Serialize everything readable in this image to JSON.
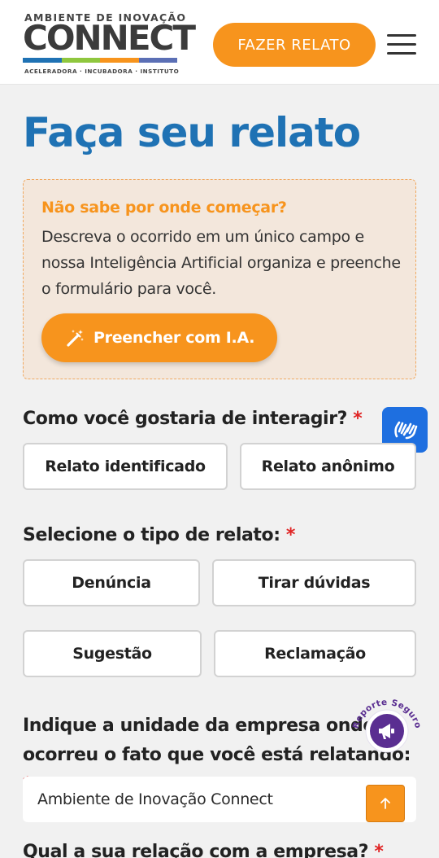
{
  "header": {
    "logo_top": "AMBIENTE DE INOVAÇÃO",
    "logo_main": "CONNECT",
    "logo_sub": "ACELERADORA · INCUBADORA · INSTITUTO",
    "logo_bar_colors": [
      "#1f72b4",
      "#8fc73e",
      "#f7941d",
      "#5b6fb5"
    ],
    "cta_label": "FAZER RELATO",
    "menu_icon": "hamburger-menu-icon"
  },
  "page": {
    "title": "Faça seu relato"
  },
  "ai_box": {
    "heading": "Não sabe por onde começar?",
    "text": "Descreva o ocorrido em um único campo e nossa Inteligência Artificial organiza e preenche o formulário para você.",
    "button_label": "Preencher com I.A.",
    "button_icon": "magic-wand-icon"
  },
  "interaction": {
    "label": "Como você gostaria de interagir?",
    "required_mark": "*",
    "options": [
      "Relato identificado",
      "Relato anônimo"
    ]
  },
  "report_type": {
    "label": "Selecione o tipo de relato:",
    "required_mark": "*",
    "options": [
      "Denúncia",
      "Tirar dúvidas",
      "Sugestão",
      "Reclamação"
    ]
  },
  "unit": {
    "label": "Indique a unidade da empresa onde ocorreu o fato que você está relatando:",
    "required_mark": "*",
    "selected_value": "Ambiente de Inovação Connect"
  },
  "relation": {
    "label": "Qual a sua relação com a empresa?",
    "required_mark": "*"
  },
  "widgets": {
    "accessibility_icon": "sign-language-hands-icon",
    "reporte_seguro_text": "Reporte Seguro",
    "reporte_icon": "megaphone-icon",
    "scroll_top_icon": "arrow-up-icon"
  },
  "colors": {
    "brand_blue": "#1f72b4",
    "brand_orange": "#f7941d",
    "required_red": "#e02424",
    "ai_box_bg": "#f3e7dc",
    "vlibras_blue": "#1e6fe0"
  }
}
